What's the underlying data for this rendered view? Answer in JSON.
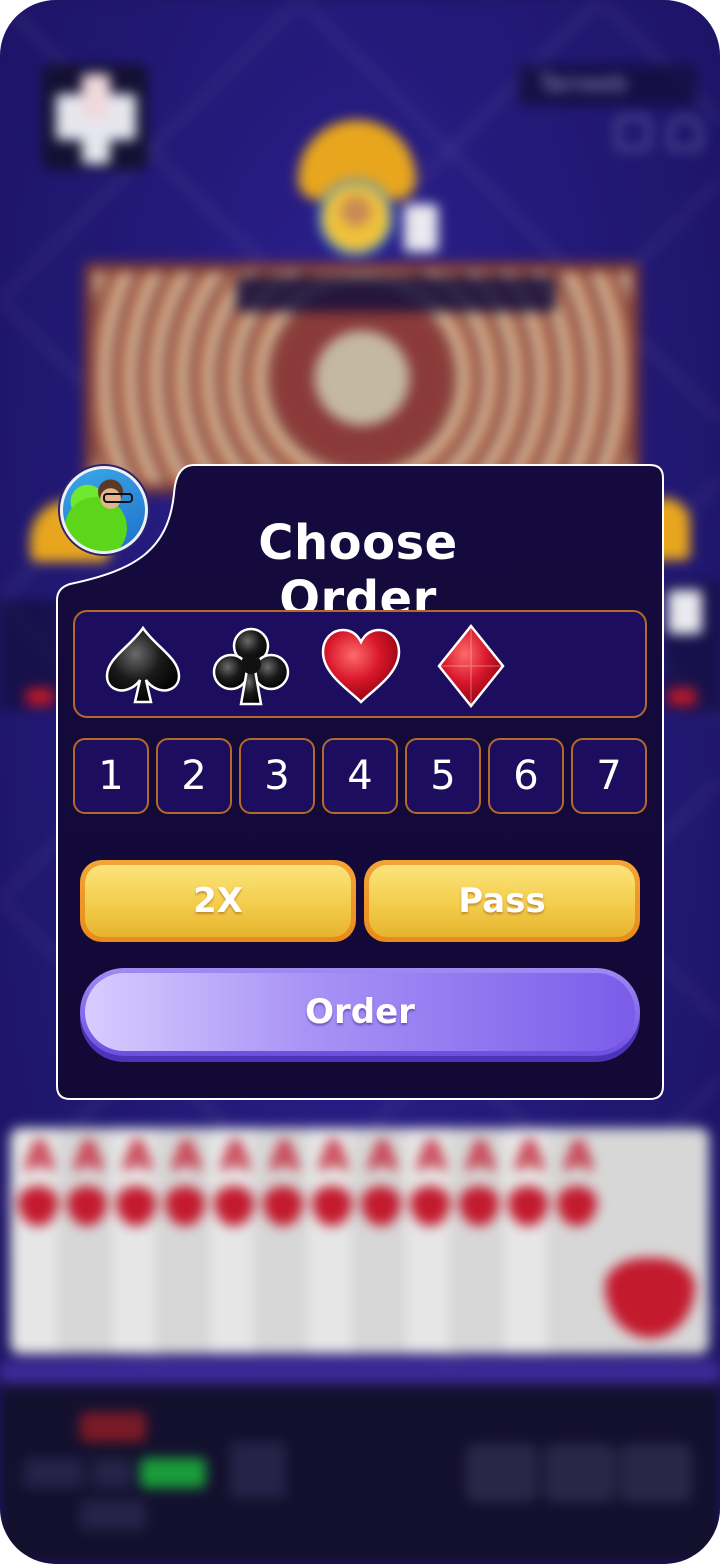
{
  "background": {
    "game_name": "Tarneeb",
    "colors": {
      "table": "#1f1566",
      "gold": "#e8a61e",
      "card_red": "#c31a2e"
    }
  },
  "modal": {
    "title": "Choose Order",
    "suits": [
      {
        "name": "spade",
        "icon": "spade-icon",
        "color": "#111111"
      },
      {
        "name": "club",
        "icon": "club-icon",
        "color": "#111111"
      },
      {
        "name": "heart",
        "icon": "heart-icon",
        "color": "#d21c2c"
      },
      {
        "name": "diamond",
        "icon": "diamond-icon",
        "color": "#d21c2c"
      }
    ],
    "numbers": [
      "1",
      "2",
      "3",
      "4",
      "5",
      "6",
      "7"
    ],
    "double_label": "2X",
    "pass_label": "Pass",
    "order_label": "Order"
  },
  "hand": {
    "card_rank": "A",
    "card_count": 12
  }
}
